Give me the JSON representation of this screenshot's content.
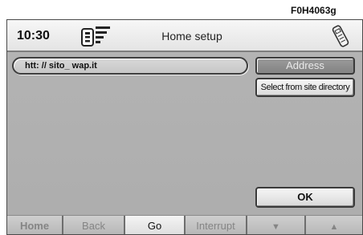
{
  "figure_code": "F0H4063g",
  "status_bar": {
    "time": "10:30",
    "title": "Home setup",
    "phone_status_icon": "phone-signal-icon",
    "handset_icon": "handset-icon"
  },
  "url_field": {
    "value": "htt: // sito_ wap.it"
  },
  "buttons": {
    "address": "Address",
    "select_directory": "Select from site directory",
    "ok": "OK"
  },
  "soft_keys": [
    {
      "label": "Home",
      "enabled": false
    },
    {
      "label": "Back",
      "enabled": false
    },
    {
      "label": "Go",
      "enabled": true
    },
    {
      "label": "Interrupt",
      "enabled": false
    },
    {
      "label": "▼",
      "icon": "arrow-down-icon",
      "enabled": false
    },
    {
      "label": "▲",
      "icon": "arrow-up-icon",
      "enabled": false
    }
  ],
  "colors": {
    "screen_background": "#b0b0b0",
    "header_background": "#efefef",
    "disabled_text": "#858585"
  }
}
